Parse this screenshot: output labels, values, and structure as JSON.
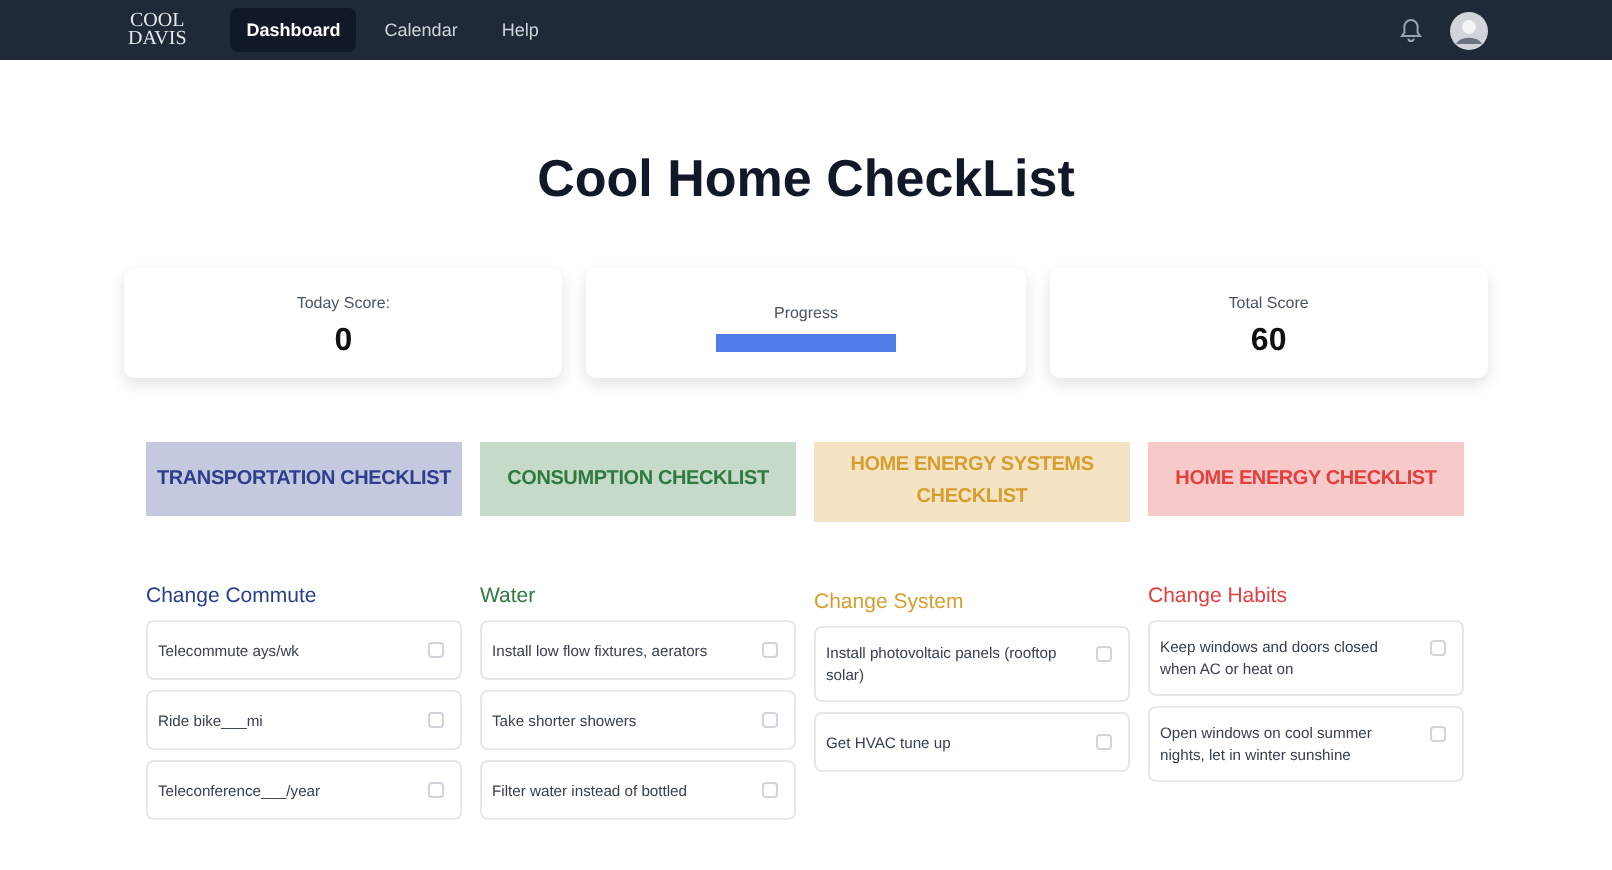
{
  "nav": {
    "logo": [
      "COOL",
      "DAVIS"
    ],
    "links": [
      {
        "label": "Dashboard",
        "selected": true
      },
      {
        "label": "Calendar",
        "selected": false
      },
      {
        "label": "Help",
        "selected": false
      }
    ]
  },
  "title": "Cool Home CheckList",
  "stats": [
    {
      "kind": "score",
      "label": "Today Score:",
      "value": "0"
    },
    {
      "kind": "progress",
      "label": "Progress",
      "level": 1
    },
    {
      "kind": "score",
      "label": "Total Score",
      "value": "60"
    }
  ],
  "checklists": [
    {
      "title": "TRANSPORTATION CHECKLIST",
      "color": "#2c3e8c",
      "section": "Change Commute",
      "items": [
        {
          "text": "Telecommute ays/wk",
          "checked": false
        },
        {
          "text": "Ride bike___mi",
          "checked": false
        },
        {
          "text": "Teleconference___/year",
          "checked": false
        }
      ]
    },
    {
      "title": "CONSUMPTION CHECKLIST",
      "color": "#2f7a3f",
      "section": "Water",
      "items": [
        {
          "text": "Install low flow fixtures, aerators",
          "checked": false
        },
        {
          "text": "Take shorter showers",
          "checked": false
        },
        {
          "text": "Filter water instead of bottled",
          "checked": false
        }
      ]
    },
    {
      "title": "HOME ENERGY SYSTEMS CHECKLIST",
      "color": "#d69e2e",
      "section": "Change System",
      "items": [
        {
          "text": "Install photovoltaic panels (rooftop solar)",
          "checked": false
        },
        {
          "text": "Get HVAC tune up",
          "checked": false
        }
      ]
    },
    {
      "title": "HOME ENERGY CHECKLIST",
      "color": "#e53e3e",
      "section": "Change Habits",
      "items": [
        {
          "text": "Keep windows and doors closed when AC or heat on",
          "checked": false
        },
        {
          "text": "Open windows on cool summer nights, let in winter sunshine",
          "checked": false
        }
      ]
    }
  ]
}
